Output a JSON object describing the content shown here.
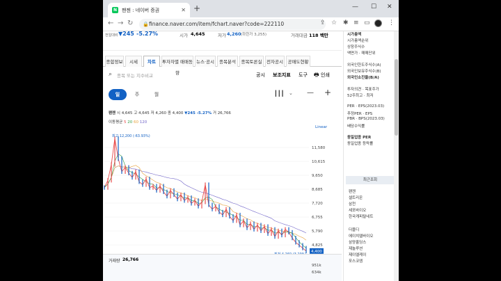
{
  "browser": {
    "tab_title": "팬젠 : 네이버 증권",
    "url": "finance.naver.com/item/fchart.naver?code=222110"
  },
  "summary": {
    "prev_label": "전일대비",
    "change": "▼245",
    "change_pct": "-5.27%",
    "open_label": "시가",
    "open": "4,645",
    "low_label": "저가",
    "low": "4,260",
    "low_limit": "(하한가 3,255)",
    "value_label": "거래대금",
    "value": "118 백만"
  },
  "page_tabs": [
    "종합정보",
    "시세",
    "차트",
    "투자자별 매매동향",
    "뉴스·공시",
    "종목분석",
    "종목토론실",
    "전자공시",
    "공매도현황"
  ],
  "tools": {
    "search_placeholder": "종목 또는 지수비교",
    "notice": "공시",
    "indicators": "보조지표",
    "draw": "도구",
    "print": "인쇄"
  },
  "periods": [
    "일",
    "주",
    "월"
  ],
  "ohlc": {
    "name": "팬젠",
    "open_lab": "시",
    "open": "4,645",
    "high_lab": "고",
    "high": "4,645",
    "low_lab": "저",
    "low": "4,260",
    "close_lab": "종",
    "close": "4,400",
    "change": "▼245 -5.27%",
    "vol_lab": "거",
    "vol": "26,766"
  },
  "ma": {
    "label": "이동평균",
    "v1": "5",
    "v2": "20",
    "v3": "60",
    "v4": "120"
  },
  "scale": "Linear",
  "chart_data": {
    "type": "line",
    "y_ticks": [
      "11,580",
      "10,615",
      "9,650",
      "8,685",
      "7,720",
      "6,755",
      "5,790",
      "4,825"
    ],
    "ylim": [
      4200,
      12400
    ],
    "max_label": "최고 12,200 (-63.93%)",
    "min_label": "최저 4,260 (3.29%)",
    "current_price": "4,400",
    "colors": {
      "price": "#e84c4c",
      "ma5": "#2f9b44",
      "ma20": "#e8a23c",
      "ma60": "#6f63c8",
      "ma120": "#4aa3df"
    },
    "series": [
      {
        "name": "",
        "values": [
          8800,
          9300,
          10400,
          12200,
          10800,
          9900,
          10200,
          9800,
          9500,
          9900,
          9200,
          9000,
          9400,
          8800,
          8900,
          8600,
          8900,
          8500,
          8200,
          8600,
          8300,
          8000,
          8300,
          7900,
          8100,
          7700,
          7900,
          7500,
          7800,
          9000,
          7600,
          7300,
          7500,
          7100,
          6900,
          7300,
          6800,
          6500,
          6900,
          6200,
          6500,
          6000,
          6300,
          5900,
          6200,
          5800,
          6100,
          5600,
          5900,
          5400,
          5800,
          5500,
          5900,
          5700,
          5300,
          5000,
          4800,
          4600,
          4400
        ]
      }
    ]
  },
  "volume": {
    "label": "거래량",
    "value": "26,766",
    "ticks": [
      "951k",
      "634k"
    ]
  },
  "side": {
    "items": [
      "시가총액",
      "시가총액순위",
      "상장주식수",
      "액면가 · 매매단위",
      "외국인한도주식수(A)",
      "외국인보유주식수(B)",
      "외국인소진율(B/A)",
      "투자의견 · 목표주가",
      "52주최고 · 최저",
      "PER · EPS(2023.03)",
      "추정PER · EPS",
      "PBR · BPS(2023.03)",
      "배당수익률",
      "동일업종 PER",
      "동일업종 등락률"
    ],
    "recent_title": "최근조회",
    "recent": [
      "팬젠",
      "셀트리온",
      "삼천",
      "세포바이오",
      "한국캐피탈네트"
    ],
    "recent2": [
      "더블디",
      "에이치엘바이오",
      "삼양홀딩스",
      "제놀루션",
      "제이엘케이",
      "포스코엠"
    ]
  }
}
